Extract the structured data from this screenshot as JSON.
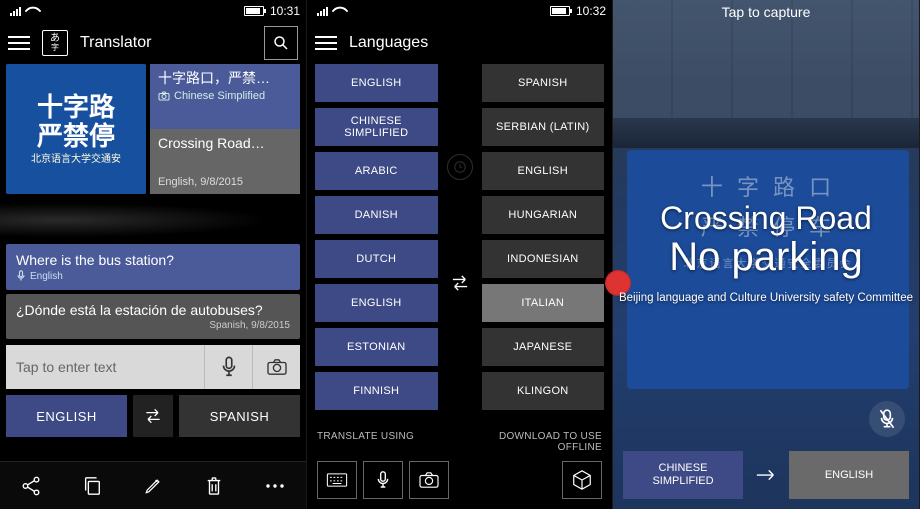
{
  "phone1": {
    "status": {
      "time": "10:31"
    },
    "appbar": {
      "title": "Translator",
      "logo_top": "あ",
      "logo_bot": "字"
    },
    "hero": {
      "sign_line1": "十字路",
      "sign_line2": "严禁停",
      "sign_small": "北京语言大学交通安",
      "card_top_title": "十字路口，严禁…",
      "card_top_sub": "Chinese Simplified",
      "card_bot_title": "Crossing Road…",
      "card_bot_sub": "English, 9/8/2015"
    },
    "bubble_src": {
      "text": "Where is the bus station?",
      "meta": "English"
    },
    "bubble_dst": {
      "text": "¿Dónde está la estación de autobuses?",
      "meta": "Spanish, 9/8/2015"
    },
    "input_placeholder": "Tap to enter text",
    "src_lang": "ENGLISH",
    "dst_lang": "SPANISH"
  },
  "phone2": {
    "status": {
      "time": "10:32"
    },
    "title": "Languages",
    "left": [
      "ENGLISH",
      "CHINESE SIMPLIFIED",
      "ARABIC",
      "DANISH",
      "DUTCH",
      "ENGLISH",
      "ESTONIAN",
      "FINNISH"
    ],
    "left_selected_index": 5,
    "right": [
      "SPANISH",
      "SERBIAN (LATIN)",
      "ENGLISH",
      "HUNGARIAN",
      "INDONESIAN",
      "ITALIAN",
      "JAPANESE",
      "KLINGON"
    ],
    "right_selected_index": 5,
    "translate_using_label": "TRANSLATE USING",
    "download_label_l1": "DOWNLOAD TO USE",
    "download_label_l2": "OFFLINE"
  },
  "phone3": {
    "top": "Tap to capture",
    "sign_cn1": "十 字 路 口",
    "sign_cn2": "严 禁 停 车",
    "sign_cn3": "北京语言大学交通安全委员会",
    "overlay_l1": "Crossing Road",
    "overlay_l2": "No parking",
    "overlay_l3": "Beijing language and Culture University safety Committee",
    "src_lang_l1": "CHINESE",
    "src_lang_l2": "SIMPLIFIED",
    "dst_lang": "ENGLISH"
  },
  "colors": {
    "accent": "#3d4a85"
  }
}
